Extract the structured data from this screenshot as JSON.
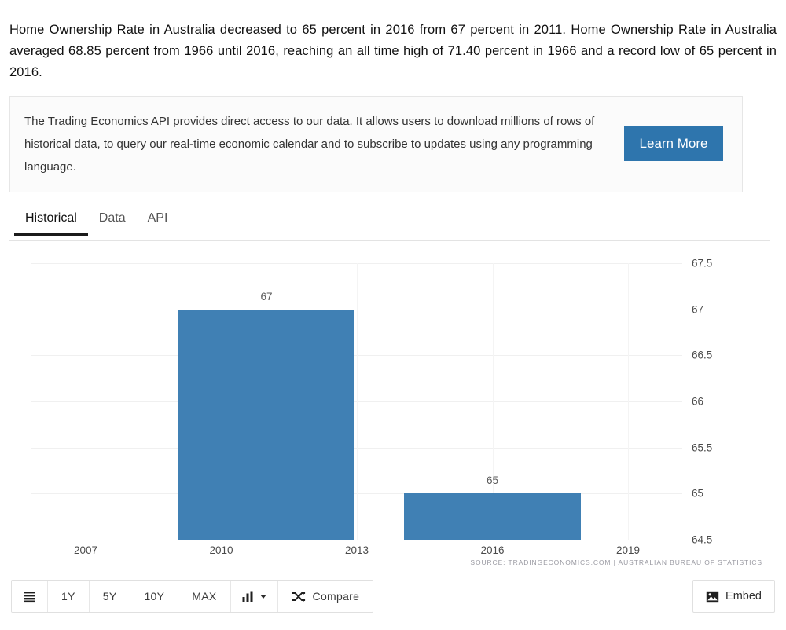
{
  "intro": {
    "paragraph": "Home Ownership Rate in Australia decreased to 65 percent in 2016 from 67 percent in 2011. Home Ownership Rate in Australia averaged 68.85 percent from 1966 until 2016, reaching an all time high of 71.40 percent in 1966 and a record low of 65 percent in 2016."
  },
  "api_promo": {
    "text": "The Trading Economics API provides direct access to our data. It allows users to download millions of rows of historical data, to query our real-time economic calendar and to subscribe to updates using any programming language.",
    "button_label": "Learn More",
    "button_color": "#2e75ad"
  },
  "tabs": [
    {
      "label": "Historical",
      "active": true
    },
    {
      "label": "Data",
      "active": false
    },
    {
      "label": "API",
      "active": false
    }
  ],
  "toolbar": {
    "list_icon": "list-icon",
    "ranges": [
      "1Y",
      "5Y",
      "10Y",
      "MAX"
    ],
    "chart_type_icon": "bar-chart-icon",
    "compare_icon": "shuffle-icon",
    "compare_label": "Compare",
    "embed_icon": "image-icon",
    "embed_label": "Embed"
  },
  "chart_data": {
    "type": "bar",
    "title": "",
    "xlabel": "",
    "ylabel": "",
    "categories": [
      "2011",
      "2016"
    ],
    "values": [
      67,
      65
    ],
    "bar_labels": [
      "67",
      "65"
    ],
    "bar_color": "#4080b4",
    "x_ticks": [
      "2007",
      "2010",
      "2013",
      "2016",
      "2019"
    ],
    "x_tick_values": [
      2007,
      2010,
      2013,
      2016,
      2019
    ],
    "y_ticks": [
      "67.5",
      "67",
      "66.5",
      "66",
      "65.5",
      "65",
      "64.5"
    ],
    "y_tick_values": [
      67.5,
      67,
      66.5,
      66,
      65.5,
      65,
      64.5
    ],
    "ylim": [
      64.5,
      67.5
    ],
    "xlim": [
      2005.8,
      2020.2
    ],
    "grid": true,
    "legend": "none",
    "y_axis_position": "right",
    "source": "SOURCE: TRADINGECONOMICS.COM | AUSTRALIAN BUREAU OF STATISTICS"
  }
}
